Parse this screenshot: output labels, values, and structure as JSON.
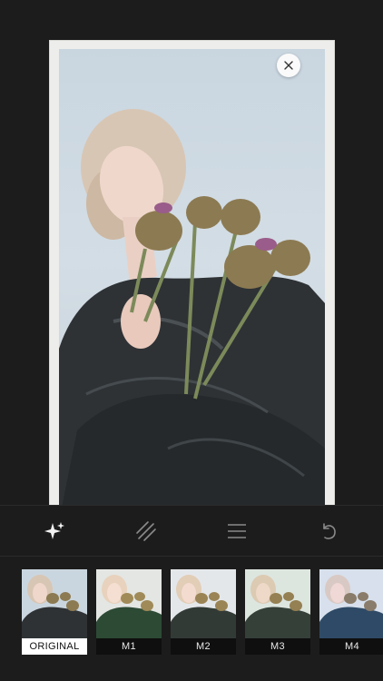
{
  "toolbar": {
    "tools": [
      {
        "icon": "sparkle-icon"
      },
      {
        "icon": "texture-icon"
      },
      {
        "icon": "adjust-icon"
      },
      {
        "icon": "undo-icon"
      }
    ]
  },
  "filters": [
    {
      "label": "ORIGINAL",
      "selected": true
    },
    {
      "label": "M1",
      "selected": false
    },
    {
      "label": "M2",
      "selected": false
    },
    {
      "label": "M3",
      "selected": false
    },
    {
      "label": "M4",
      "selected": false
    }
  ],
  "colors": {
    "background": "#1c1c1c",
    "frame": "#ededeb",
    "sky": "#cbd7e0",
    "jacket": "#2e3235"
  }
}
